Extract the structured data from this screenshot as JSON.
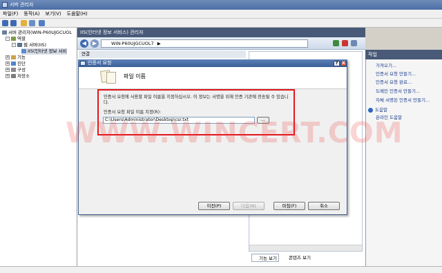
{
  "window": {
    "title": "서버 관리자"
  },
  "menu": {
    "items": [
      "파일(F)",
      "동작(A)",
      "보기(V)",
      "도움말(H)"
    ]
  },
  "tree": {
    "root": "서버 관리자(WIN-P60UJGCUOL",
    "roles": "역할",
    "webserver": "웹 서버(IIS)",
    "iis": "IIS(인터넷 정보 서비",
    "features": "기능",
    "diagnostics": "진단",
    "config": "구성",
    "storage": "저장소"
  },
  "center": {
    "header": "IIS(인터넷 정보 서비스) 관리자",
    "address": "WIN-P60UJGCUOL7",
    "address_arrow": "▶",
    "connections_header": "연결",
    "tab_features": "기능 보기",
    "tab_content": "콘텐츠 보기"
  },
  "actions": {
    "header": "작업",
    "items": [
      "가져오기...",
      "인증서 요청 만들기...",
      "인증서 요청 완료...",
      "도메인 인증서 만들기...",
      "자체 서명된 인증서 만들기..."
    ],
    "help": "도움말",
    "online_help": "온라인 도움말"
  },
  "dialog": {
    "title": "인증서 요청",
    "help_btn": "?",
    "close_btn": "X",
    "heading": "파일 이름",
    "description": "인증서 요청에 사용할 파일 이름을 지정하십시오. 이 정보는 서명을 위해 인증 기관에 전송될 수 있습니다.",
    "path_label": "인증서 요청 파일 이름 지정(R):",
    "path_value": "C:\\Users\\Administrator\\Desktop\\csr.txt",
    "browse": "...",
    "buttons": {
      "prev": "이전(P)",
      "next": "다음(N)",
      "finish": "마침(F)",
      "cancel": "취소"
    }
  },
  "watermark": "WWW.WINCERT.COM"
}
